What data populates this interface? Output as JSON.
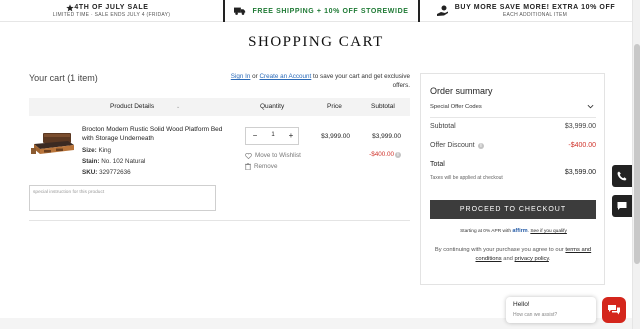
{
  "promo": {
    "july_title": "4TH OF JULY SALE",
    "july_sub": "LIMITED TIME · SALE ENDS JULY 4 (FRIDAY)",
    "shipping": "FREE SHIPPING + 10% OFF STOREWIDE",
    "save_title": "BUY MORE SAVE MORE! EXTRA 10% OFF",
    "save_sub": "EACH ADDITIONAL ITEM"
  },
  "page_title": "SHOPPING CART",
  "cart": {
    "count_label": "Your cart (1 item)",
    "signin_link": "Sign In",
    "or": "or",
    "create_account_link": "Create an Account",
    "signin_rest": "to save your cart and get exclusive offers."
  },
  "table_headers": {
    "product": "Product Details",
    "quantity": "Quantity",
    "price": "Price",
    "subtotal": "Subtotal"
  },
  "item": {
    "name": "Brocton Modern Rustic Solid Wood Platform Bed with Storage Underneath",
    "size_label": "Size:",
    "size_value": "King",
    "stain_label": "Stain:",
    "stain_value": "No. 102 Natural",
    "sku_label": "SKU:",
    "sku_value": "329772636",
    "quantity": "1",
    "qty_minus": "−",
    "qty_plus": "+",
    "move_to_wishlist": "Move to Wishlist",
    "remove": "Remove",
    "price": "$3,999.00",
    "subtotal": "$3,999.00",
    "discount": "-$400.00"
  },
  "instructions_placeholder": "special instruction for this product",
  "summary": {
    "title": "Order summary",
    "special_codes": "Special Offer Codes",
    "subtotal_label": "Subtotal",
    "subtotal_value": "$3,999.00",
    "discount_label": "Offer Discount",
    "discount_value": "-$400.00",
    "total_label": "Total",
    "total_value": "$3,599.00",
    "tax_note": "Taxes will be applied at checkout",
    "checkout_button": "PROCEED TO CHECKOUT",
    "apr_prefix": "Starting at 0% APR with",
    "affirm": "affirm",
    "see_if_qualify": "See if you qualify",
    "terms_prefix": "By continuing with your purchase you agree to our",
    "terms_link": "terms and conditions",
    "and": "and",
    "privacy_link": "privacy policy",
    "period": "."
  },
  "chat": {
    "hello": "Hello!",
    "prompt": "How can we assist?"
  },
  "colors": {
    "accent_red": "#d0342c",
    "link_blue": "#2a6ab8",
    "checkout_bg": "#3c3c3c",
    "shipping_green": "#1f7a35",
    "chat_red": "#d4261c"
  },
  "icons": [
    "star-icon",
    "truck-icon",
    "hand-money-icon",
    "heart-icon",
    "trash-icon",
    "chevron-down-icon",
    "info-icon",
    "phone-icon",
    "message-icon",
    "chat-icon"
  ]
}
